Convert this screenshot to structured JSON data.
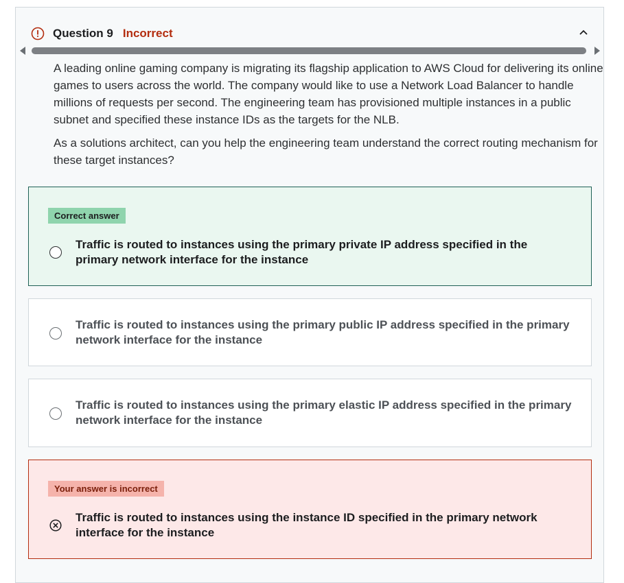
{
  "question": {
    "title": "Question 9",
    "status": "Incorrect",
    "status_color": "#b32d0f",
    "icons": {
      "status": "alert-circle-icon",
      "toggle": "chevron-up-icon"
    },
    "paragraphs": [
      "A leading online gaming company is migrating its flagship application to AWS Cloud for delivering its online games to users across the world. The company would like to use a Network Load Balancer to handle millions of requests per second. The engineering team has provisioned multiple instances in a public subnet and specified these instance IDs as the targets for the NLB.",
      "As a solutions architect, can you help the engineering team understand the correct routing mechanism for these target instances?"
    ]
  },
  "options": [
    {
      "badge": "Correct answer",
      "text": "Traffic is routed to instances using the primary private IP address specified in the primary network interface for the instance",
      "state": "correct"
    },
    {
      "text": "Traffic is routed to instances using the primary public IP address specified in the primary network interface for the instance",
      "state": "neutral"
    },
    {
      "text": "Traffic is routed to instances using the primary elastic IP address specified in the primary network interface for the instance",
      "state": "neutral"
    },
    {
      "badge": "Your answer is incorrect",
      "text": "Traffic is routed to instances using the instance ID specified in the primary network interface for the instance",
      "state": "incorrect"
    }
  ],
  "colors": {
    "correct_bg": "#eaf7f0",
    "correct_border": "#1e6055",
    "incorrect_bg": "#fde8e8",
    "incorrect_border": "#b32d0f"
  }
}
